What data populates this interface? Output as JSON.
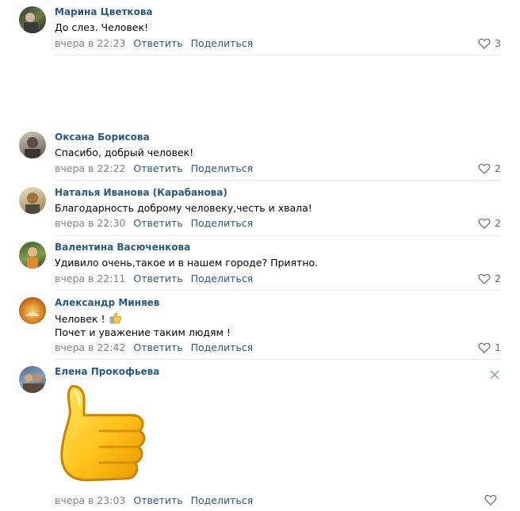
{
  "comments": [
    {
      "author": "Марина Цветкова",
      "lines": [
        "До слез. Человек!"
      ],
      "date": "вчера в 22:23",
      "reply": "Ответить",
      "share": "Поделиться",
      "likes": "3"
    },
    {
      "author": "Оксана Борисова",
      "lines": [
        "Спасибо, добрый человек!"
      ],
      "date": "вчера в 22:22",
      "reply": "Ответить",
      "share": "Поделиться",
      "likes": "2"
    },
    {
      "author": "Наталья Иванова (Карабанова)",
      "lines": [
        "Благодарность доброму человеку,честь и хвала!"
      ],
      "date": "вчера в 22:30",
      "reply": "Ответить",
      "share": "Поделиться",
      "likes": "2"
    },
    {
      "author": "Валентина Васюченкова",
      "lines": [
        "Удивило очень,такое и в нашем городе? Приятно."
      ],
      "date": "вчера в 22:11",
      "reply": "Ответить",
      "share": "Поделиться",
      "likes": "2"
    },
    {
      "author": "Александр Миняев",
      "lines": [
        "Человек !",
        "Почет и уважение таким людям !"
      ],
      "date": "вчера в 22:42",
      "reply": "Ответить",
      "share": "Поделиться",
      "likes": "1"
    },
    {
      "author": "Елена Прокофьева",
      "lines": [],
      "date": "вчера в 23:03",
      "reply": "Ответить",
      "share": "Поделиться",
      "likes": ""
    }
  ],
  "icons": {
    "like": "heart-icon",
    "close": "close-icon",
    "sticker": "thumbs-up-sticker",
    "emoji": "thumbs-up-emoji"
  },
  "colors": {
    "link": "#2a5885",
    "muted": "#828282",
    "separator": "#e7e8ec"
  }
}
